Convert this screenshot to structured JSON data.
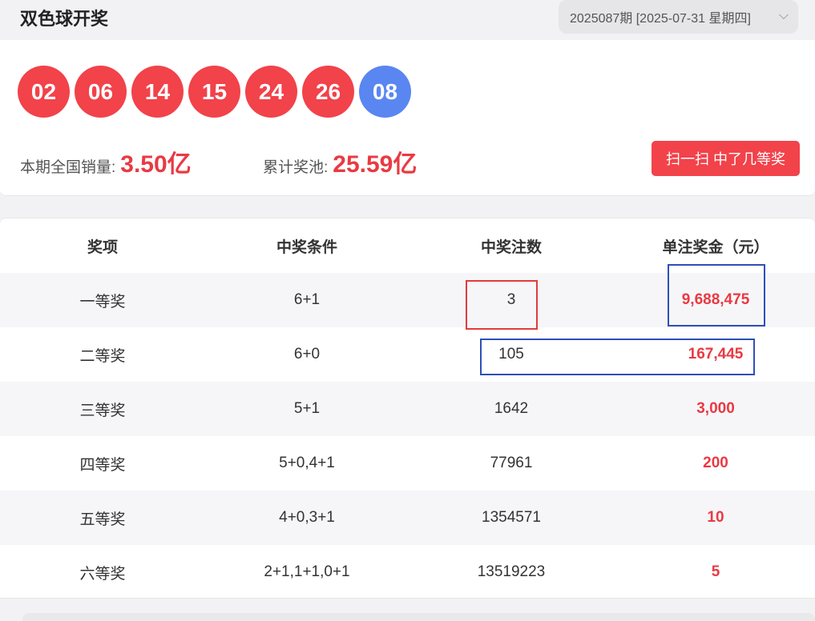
{
  "header": {
    "title": "双色球开奖",
    "issue_select": "2025087期 [2025-07-31 星期四]",
    "chevron_icon": "chevron-down-icon"
  },
  "draw": {
    "red_balls": [
      "02",
      "06",
      "14",
      "15",
      "24",
      "26"
    ],
    "blue_ball": "08",
    "sales_label": "本期全国销量:",
    "sales_value": "3.50亿",
    "pool_label": "累计奖池:",
    "pool_value": "25.59亿",
    "scan_button": "扫一扫 中了几等奖"
  },
  "colors": {
    "red_ball": "#f2424a",
    "blue_ball": "#5a86f2",
    "accent_text": "#e93a43",
    "annotation_red": "#e23b3b",
    "annotation_blue": "#2e4fb8"
  },
  "table": {
    "headers": [
      "奖项",
      "中奖条件",
      "中奖注数",
      "单注奖金（元）"
    ],
    "rows": [
      {
        "prize": "一等奖",
        "condition": "6+1",
        "count": "3",
        "amount": "9,688,475"
      },
      {
        "prize": "二等奖",
        "condition": "6+0",
        "count": "105",
        "amount": "167,445"
      },
      {
        "prize": "三等奖",
        "condition": "5+1",
        "count": "1642",
        "amount": "3,000"
      },
      {
        "prize": "四等奖",
        "condition": "5+0,4+1",
        "count": "77961",
        "amount": "200"
      },
      {
        "prize": "五等奖",
        "condition": "4+0,3+1",
        "count": "1354571",
        "amount": "10"
      },
      {
        "prize": "六等奖",
        "condition": "2+1,1+1,0+1",
        "count": "13519223",
        "amount": "5"
      }
    ]
  }
}
